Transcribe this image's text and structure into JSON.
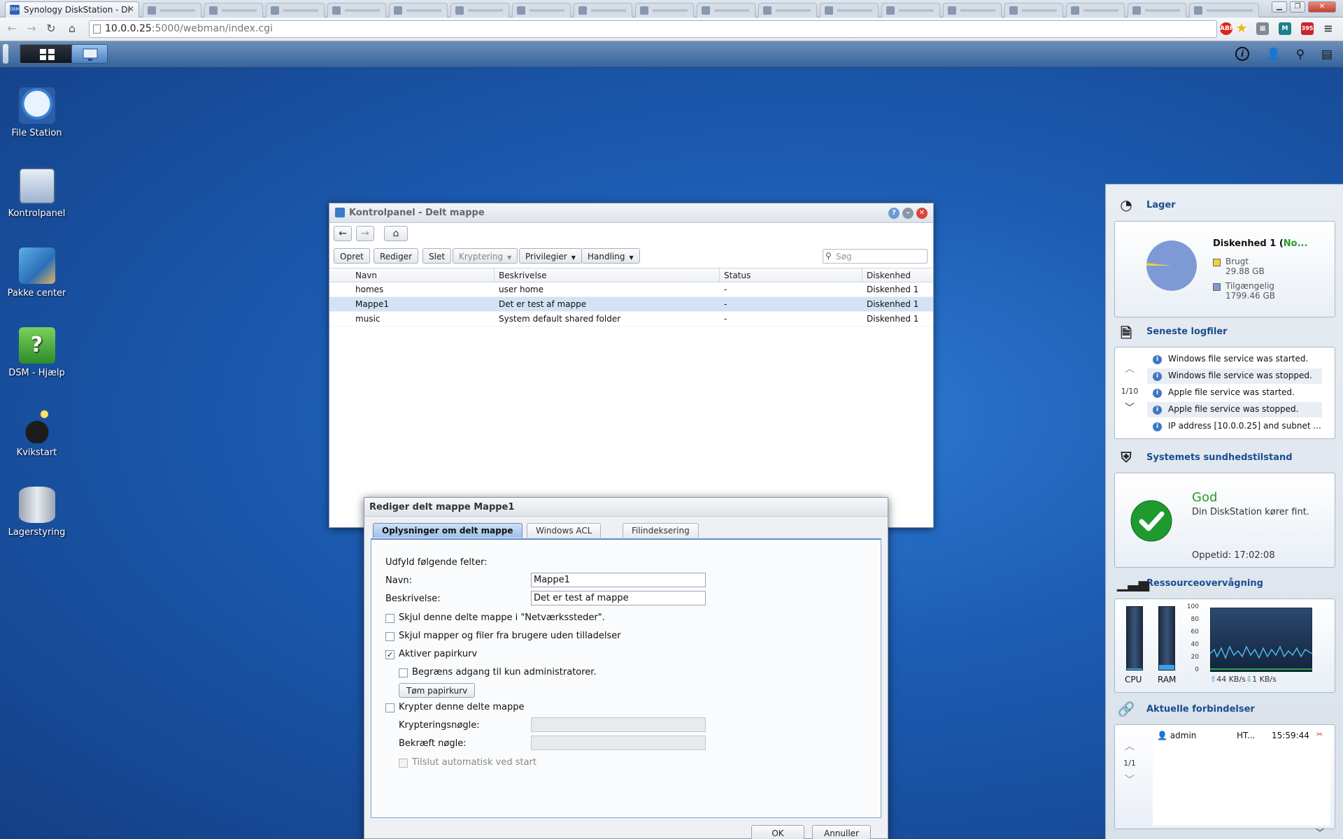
{
  "browser": {
    "active_tab": "Synology DiskStation - Di",
    "url_host": "10.0.0.25",
    "url_rest": ":5000/webman/index.cgi",
    "ext_abp": "ABP",
    "ext_m": "M",
    "ext_count": "395"
  },
  "desktop": {
    "icons": [
      {
        "label": "File Station"
      },
      {
        "label": "Kontrolpanel"
      },
      {
        "label": "Pakke center"
      },
      {
        "label": "DSM - Hjælp"
      },
      {
        "label": "Kvikstart"
      },
      {
        "label": "Lagerstyring"
      }
    ]
  },
  "main_window": {
    "title": "Kontrolpanel - Delt mappe",
    "toolbar": {
      "create": "Opret",
      "edit": "Rediger",
      "delete": "Slet",
      "encryption": "Kryptering",
      "privileges": "Privilegier",
      "action": "Handling",
      "search_placeholder": "Søg"
    },
    "columns": [
      "Navn",
      "Beskrivelse",
      "Status",
      "Diskenhed"
    ],
    "rows": [
      {
        "name": "homes",
        "description": "user home",
        "status": "-",
        "volume": "Diskenhed 1"
      },
      {
        "name": "Mappe1",
        "description": "Det er test af mappe",
        "status": "-",
        "volume": "Diskenhed 1"
      },
      {
        "name": "music",
        "description": "System default shared folder",
        "status": "-",
        "volume": "Diskenhed 1"
      }
    ]
  },
  "dialog": {
    "title": "Rediger delt mappe Mappe1",
    "tabs": [
      "Oplysninger om delt mappe",
      "Windows ACL",
      "Filindeksering"
    ],
    "intro": "Udfyld følgende felter:",
    "name_label": "Navn:",
    "name_value": "Mappe1",
    "desc_label": "Beskrivelse:",
    "desc_value": "Det er test af mappe",
    "hide_network": "Skjul denne delte mappe i \"Netværkssteder\".",
    "hide_unauth": "Skjul mapper og filer fra brugere uden tilladelser",
    "enable_recycle": "Aktiver papirkurv",
    "restrict_admin": "Begræns adgang til kun administratorer.",
    "empty_recycle": "Tøm papirkurv",
    "encrypt": "Krypter denne delte mappe",
    "enc_key": "Krypteringsnøgle:",
    "confirm_key": "Bekræft nøgle:",
    "auto_mount": "Tilslut automatisk ved start",
    "ok": "OK",
    "cancel": "Annuller"
  },
  "widgets": {
    "storage": {
      "title": "Lager",
      "volume": "Diskenhed 1 (",
      "volume_status": "No...",
      "used_label": "Brugt",
      "used_value": "29.88 GB",
      "free_label": "Tilgængelig",
      "free_value": "1799.46 GB",
      "used_color": "#f0d23c",
      "free_color": "#7d9ad4"
    },
    "logs": {
      "title": "Seneste logfiler",
      "pager": "1/10",
      "items": [
        "Windows file service was started.",
        "Windows file service was stopped.",
        "Apple file service was started.",
        "Apple file service was stopped.",
        "IP address [10.0.0.25] and subnet ..."
      ]
    },
    "health": {
      "title": "Systemets sundhedstilstand",
      "status": "God",
      "message": "Din DiskStation kører fint.",
      "uptime": "Oppetid: 17:02:08"
    },
    "resources": {
      "title": "Ressourceovervågning",
      "cpu_label": "CPU",
      "ram_label": "RAM",
      "cpu_percent": 2,
      "ram_percent": 8,
      "ticks": [
        "100",
        "80",
        "60",
        "40",
        "20",
        "0"
      ],
      "upload": "44 KB/s",
      "download": "1 KB/s"
    },
    "connections": {
      "title": "Aktuelle forbindelser",
      "pager": "1/1",
      "user": "admin",
      "type": "HT...",
      "time": "15:59:44"
    }
  }
}
